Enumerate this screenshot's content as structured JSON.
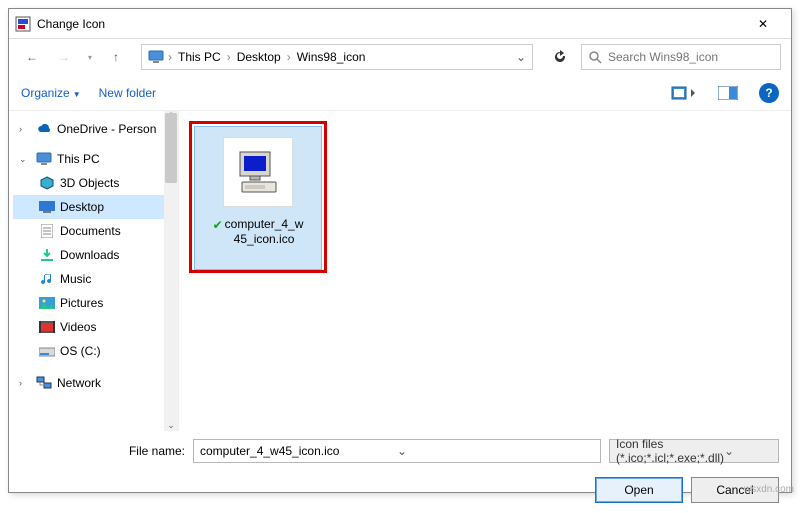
{
  "window": {
    "title": "Change Icon",
    "close": "✕"
  },
  "nav": {
    "back": "←",
    "forward": "→",
    "up": "↑"
  },
  "breadcrumb": {
    "seg1": "This PC",
    "seg2": "Desktop",
    "seg3": "Wins98_icon"
  },
  "search": {
    "placeholder": "Search Wins98_icon"
  },
  "toolbar": {
    "organize": "Organize",
    "newfolder": "New folder"
  },
  "tree": {
    "onedrive": "OneDrive - Person",
    "thispc": "This PC",
    "objects3d": "3D Objects",
    "desktop": "Desktop",
    "documents": "Documents",
    "downloads": "Downloads",
    "music": "Music",
    "pictures": "Pictures",
    "videos": "Videos",
    "osc": "OS (C:)",
    "network": "Network"
  },
  "file": {
    "name_multiline": "computer_4_w45_icon.ico",
    "line1": "computer_4_w",
    "line2": "45_icon.ico"
  },
  "footer": {
    "filename_label": "File name:",
    "filename_value": "computer_4_w45_icon.ico",
    "typefilter": "Icon files (*.ico;*.icl;*.exe;*.dll)",
    "open": "Open",
    "cancel": "Cancel"
  },
  "watermark": "wsxdn.com"
}
